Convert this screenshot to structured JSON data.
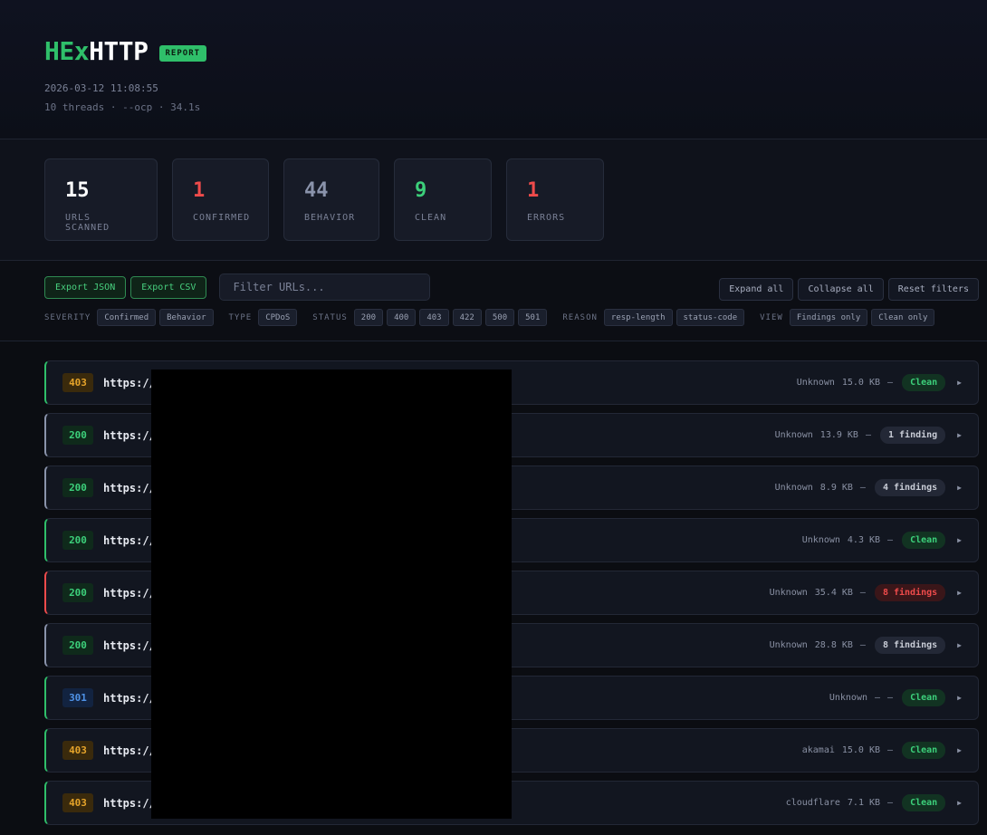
{
  "header": {
    "logo_hex": "HEx",
    "logo_http": "HTTP",
    "badge": "REPORT",
    "date": "2026-03-12 11:08:55",
    "info": "10 threads · --ocp · 34.1s"
  },
  "stats": [
    {
      "value": "15",
      "label": "URLS SCANNED",
      "color": "#ffffff"
    },
    {
      "value": "1",
      "label": "CONFIRMED",
      "color": "#ef4b4b"
    },
    {
      "value": "44",
      "label": "BEHAVIOR",
      "color": "#8a93ab"
    },
    {
      "value": "9",
      "label": "CLEAN",
      "color": "#3ccf7a"
    },
    {
      "value": "1",
      "label": "ERRORS",
      "color": "#ef4b4b"
    }
  ],
  "toolbar": {
    "export_json": "Export JSON",
    "export_csv": "Export CSV",
    "filter_placeholder": "Filter URLs...",
    "expand_all": "Expand all",
    "collapse_all": "Collapse all",
    "reset_filters": "Reset filters"
  },
  "filters": {
    "severity_label": "SEVERITY",
    "severity": [
      "Confirmed",
      "Behavior"
    ],
    "type_label": "TYPE",
    "type": [
      "CPDoS"
    ],
    "status_label": "STATUS",
    "status": [
      "200",
      "400",
      "403",
      "422",
      "500",
      "501"
    ],
    "reason_label": "REASON",
    "reason": [
      "resp-length",
      "status-code"
    ],
    "view_label": "VIEW",
    "view": [
      "Findings only",
      "Clean only"
    ]
  },
  "rows": [
    {
      "status": "403",
      "url": "https://",
      "cdn": "Unknown",
      "size": "15.0 KB",
      "dash": "–",
      "result": "Clean",
      "border": "#2fbf6a"
    },
    {
      "status": "200",
      "url": "https://",
      "cdn": "Unknown",
      "size": "13.9 KB",
      "dash": "–",
      "result": "1 finding",
      "border": "#8a93ab"
    },
    {
      "status": "200",
      "url": "https://",
      "cdn": "Unknown",
      "size": "8.9 KB",
      "dash": "–",
      "result": "4 findings",
      "border": "#8a93ab"
    },
    {
      "status": "200",
      "url": "https://",
      "cdn": "Unknown",
      "size": "4.3 KB",
      "dash": "–",
      "result": "Clean",
      "border": "#2fbf6a"
    },
    {
      "status": "200",
      "url": "https://",
      "cdn": "Unknown",
      "size": "35.4 KB",
      "dash": "–",
      "result": "8 findings",
      "border": "#ef4b4b"
    },
    {
      "status": "200",
      "url": "https://",
      "cdn": "Unknown",
      "size": "28.8 KB",
      "dash": "–",
      "result": "8 findings",
      "border": "#8a93ab"
    },
    {
      "status": "301",
      "url": "https://",
      "cdn": "Unknown",
      "size": "–",
      "dash": "–",
      "result": "Clean",
      "border": "#2fbf6a"
    },
    {
      "status": "403",
      "url": "https://",
      "cdn": "akamai",
      "size": "15.0 KB",
      "dash": "–",
      "result": "Clean",
      "border": "#2fbf6a"
    },
    {
      "status": "403",
      "url": "https://",
      "cdn": "cloudflare",
      "size": "7.1 KB",
      "dash": "–",
      "result": "Clean",
      "border": "#2fbf6a"
    }
  ]
}
